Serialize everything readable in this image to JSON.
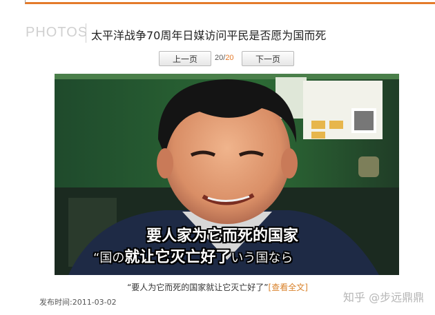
{
  "header": {
    "section_label": "PHOTOS",
    "title": "太平洋战争70周年日媒访问平民是否愿为国而死"
  },
  "pager": {
    "prev_label": "上一页",
    "current": "20",
    "separator": "/",
    "total": "20",
    "next_label": "下一页"
  },
  "photo": {
    "subtitle_line1": "要人家为它而死的国家",
    "subtitle_line2": "“国の",
    "subtitle_line2_mid": "就让它灭亡好了",
    "subtitle_line2_end": "いう国なら"
  },
  "caption": {
    "text": "“要人为它而死的国家就让它灭亡好了”",
    "link": "[查看全文]"
  },
  "meta": {
    "publish_label": "发布时间:",
    "publish_date": "2011-03-02"
  },
  "watermark": "知乎 @步远鼎鼎",
  "colors": {
    "accent": "#e47a2a",
    "link": "#d9822b"
  }
}
